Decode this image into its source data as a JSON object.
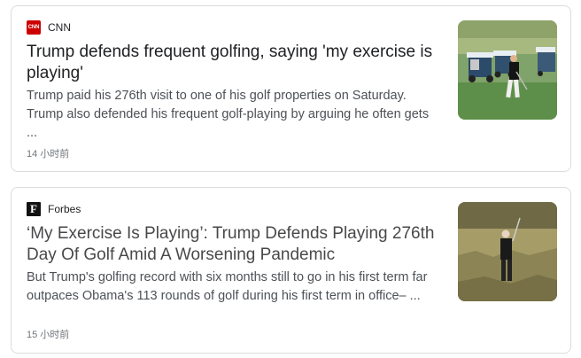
{
  "articles": [
    {
      "source": "CNN",
      "logo_text": "CNN",
      "title": "Trump defends frequent golfing, saying 'my exercise is playing'",
      "snippet": "Trump paid his 276th visit to one of his golf properties on Saturday. Trump also defended his frequent golf-playing by arguing he often gets ...",
      "time": "14 小时前",
      "thumbnail_icon": "golfer-with-carts-image"
    },
    {
      "source": "Forbes",
      "logo_text": "F",
      "title": "‘My Exercise Is Playing’: Trump Defends Playing 276th Day Of Golf Amid A Worsening Pandemic",
      "snippet": "But Trump's golfing record with six months still to go in his first term far outpaces Obama's 113 rounds of golf during his first term in office– ...",
      "time": "15 小时前",
      "thumbnail_icon": "golfer-in-rough-image"
    }
  ]
}
